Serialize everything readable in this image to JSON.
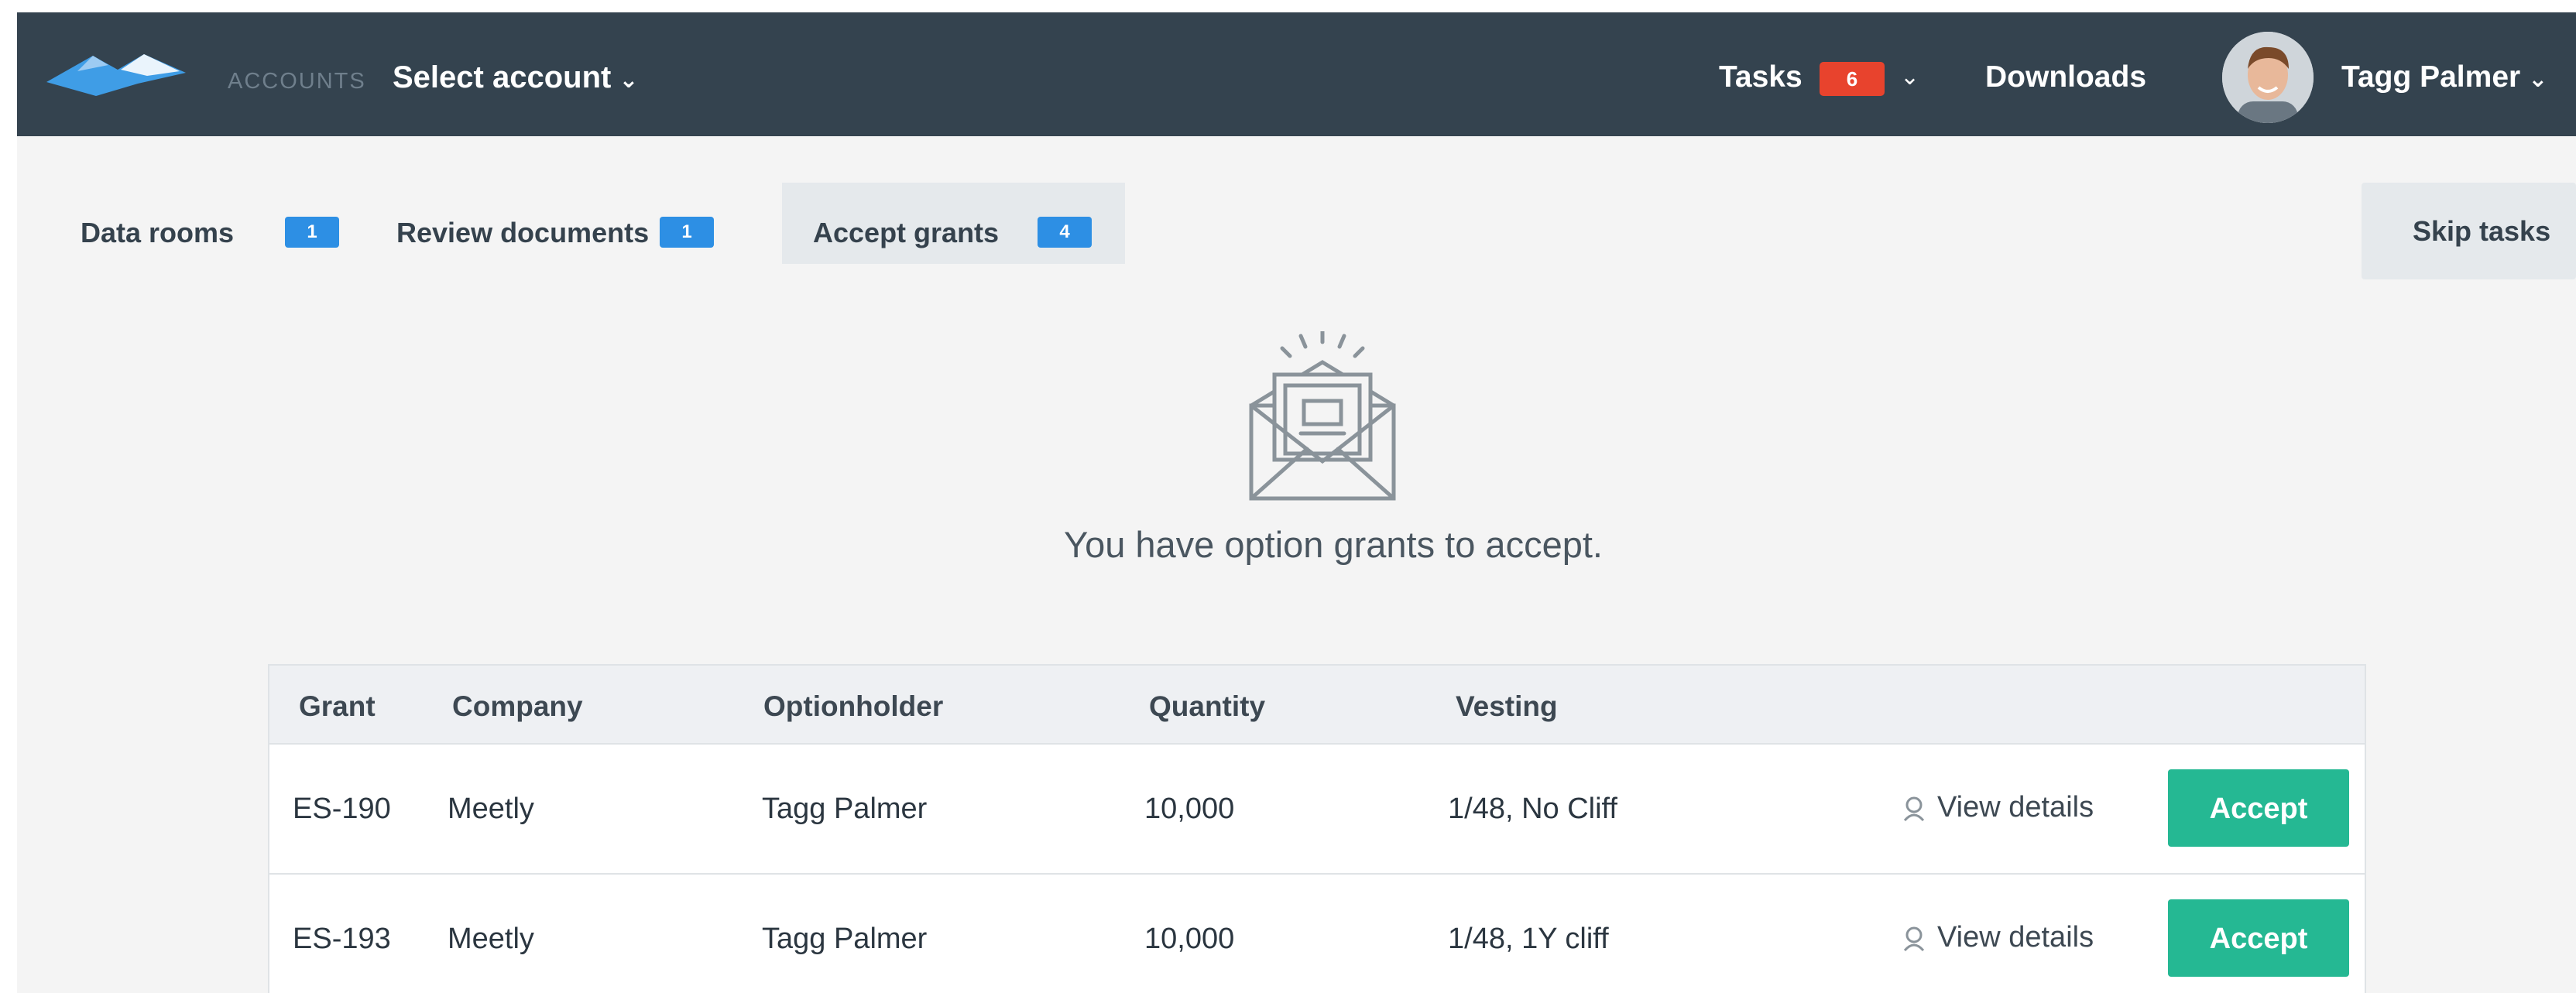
{
  "header": {
    "accounts_label": "ACCOUNTS",
    "account_select": "Select account",
    "tasks_label": "Tasks",
    "tasks_count": "6",
    "downloads_label": "Downloads",
    "user_name": "Tagg Palmer"
  },
  "tabs": [
    {
      "label": "Data rooms",
      "count": "1"
    },
    {
      "label": "Review documents",
      "count": "1"
    },
    {
      "label": "Accept grants",
      "count": "4"
    }
  ],
  "skip_label": "Skip tasks",
  "message": "You have option grants to accept.",
  "table": {
    "headers": [
      "Grant",
      "Company",
      "Optionholder",
      "Quantity",
      "Vesting"
    ],
    "rows": [
      {
        "grant": "ES-190",
        "company": "Meetly",
        "optionholder": "Tagg Palmer",
        "quantity": "10,000",
        "vesting": "1/48, No Cliff",
        "view": "View details",
        "accept": "Accept"
      },
      {
        "grant": "ES-193",
        "company": "Meetly",
        "optionholder": "Tagg Palmer",
        "quantity": "10,000",
        "vesting": "1/48, 1Y cliff",
        "view": "View details",
        "accept": "Accept"
      }
    ]
  },
  "colors": {
    "nav_bg": "#34434f",
    "tab_badge": "#2d8fe4",
    "tasks_badge": "#e8432d",
    "accept_button": "#25b893"
  },
  "icons": [
    "logo-icon",
    "chevron-down-icon",
    "avatar",
    "envelope-icon",
    "user-icon"
  ]
}
